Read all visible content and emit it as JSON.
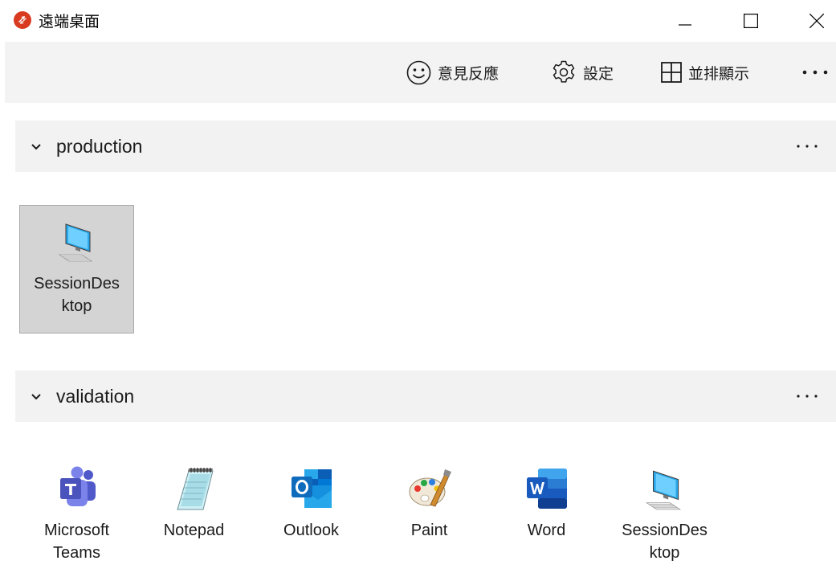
{
  "window": {
    "title": "遠端桌面",
    "app_icon": "remote-desktop-icon",
    "controls": [
      "minimize-icon",
      "maximize-icon",
      "close-icon"
    ]
  },
  "toolbar": {
    "feedback_label": "意見反應",
    "settings_label": "設定",
    "tile_label": "並排顯示",
    "more_icon": "more-horizontal-icon"
  },
  "groups": [
    {
      "name": "production",
      "items": [
        {
          "label_line1": "SessionDes",
          "label_line2": "ktop",
          "icon": "desktop-monitor-icon",
          "selected": true
        }
      ]
    },
    {
      "name": "validation",
      "items": [
        {
          "label_line1": "Microsoft",
          "label_line2": "Teams",
          "icon": "teams-icon"
        },
        {
          "label_line1": "Notepad",
          "label_line2": "",
          "icon": "notepad-icon"
        },
        {
          "label_line1": "Outlook",
          "label_line2": "",
          "icon": "outlook-icon"
        },
        {
          "label_line1": "Paint",
          "label_line2": "",
          "icon": "paint-icon"
        },
        {
          "label_line1": "Word",
          "label_line2": "",
          "icon": "word-icon"
        },
        {
          "label_line1": "SessionDes",
          "label_line2": "ktop",
          "icon": "desktop-monitor-icon"
        }
      ]
    }
  ],
  "colors": {
    "toolbar_bg": "#f3f3f3",
    "group_header_bg": "#f2f2f2",
    "selected_tile_bg": "#d4d4d4",
    "app_icon_red": "#d83b1f"
  }
}
